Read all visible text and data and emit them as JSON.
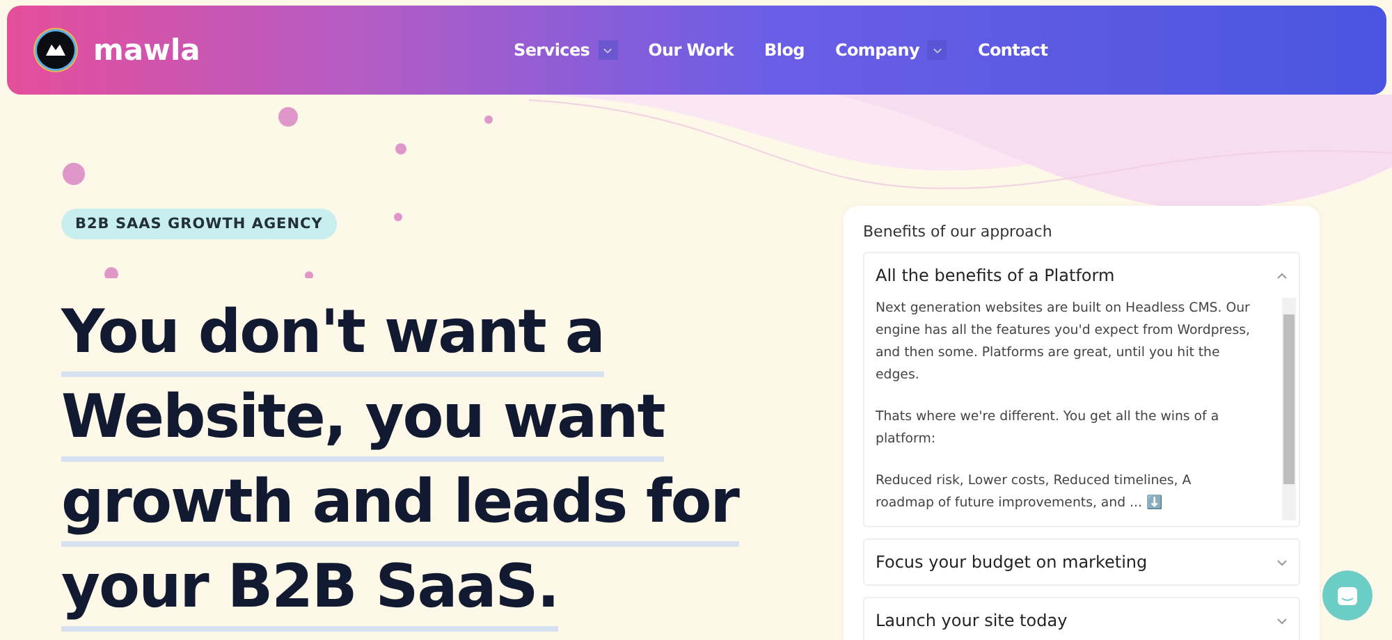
{
  "header": {
    "brand": "mawla",
    "nav": [
      {
        "label": "Services",
        "has_dropdown": true
      },
      {
        "label": "Our Work",
        "has_dropdown": false
      },
      {
        "label": "Blog",
        "has_dropdown": false
      },
      {
        "label": "Company",
        "has_dropdown": true
      },
      {
        "label": "Contact",
        "has_dropdown": false
      }
    ]
  },
  "hero": {
    "badge": "B2B SAAS GROWTH AGENCY",
    "headline": [
      "You don't want a",
      "Website, you want",
      "growth and leads for",
      "your B2B SaaS."
    ]
  },
  "benefits": {
    "title": "Benefits of our approach",
    "items": [
      {
        "title": "All the benefits of a Platform",
        "expanded": true,
        "paragraphs": [
          "Next generation websites are built on Headless CMS. Our engine has all the features you'd expect from Wordpress, and then some. Platforms are great, until you hit the edges.",
          "Thats where we're different. You get all the wins of a platform:",
          "Reduced risk, Lower costs, Reduced timelines, A roadmap of future improvements, and ... ⬇️"
        ]
      },
      {
        "title": "Focus your budget on marketing",
        "expanded": false
      },
      {
        "title": "Launch your site today",
        "expanded": false
      }
    ]
  }
}
